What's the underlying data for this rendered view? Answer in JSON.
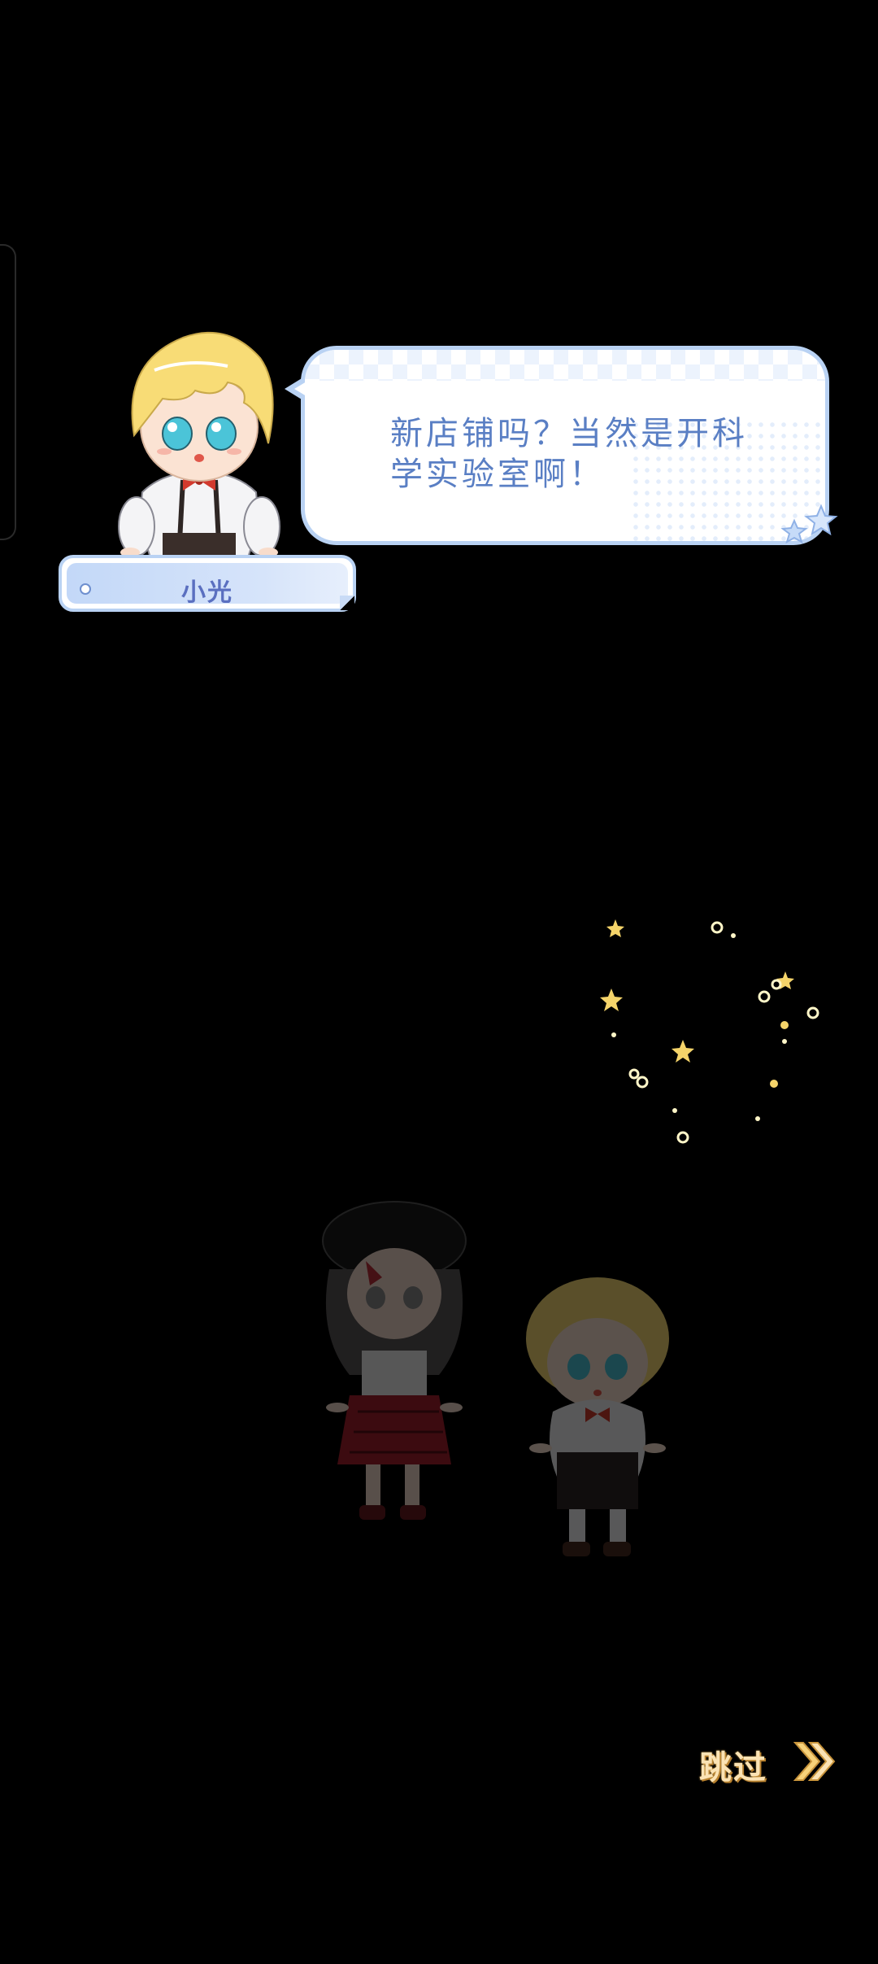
{
  "dialogue": {
    "speaker": "小光",
    "text": "新店铺吗？当然是开科学实验室啊！"
  },
  "controls": {
    "skip_label": "跳过"
  },
  "icons": {
    "skip": "double-chevron-right-icon",
    "decoration": "star-icon"
  },
  "colors": {
    "background": "#000000",
    "bubble_border": "#b9d2f3",
    "dialogue_text": "#5a7fc4",
    "skip_text": "#fbe3b4",
    "sparkle": "#f5d46a"
  }
}
